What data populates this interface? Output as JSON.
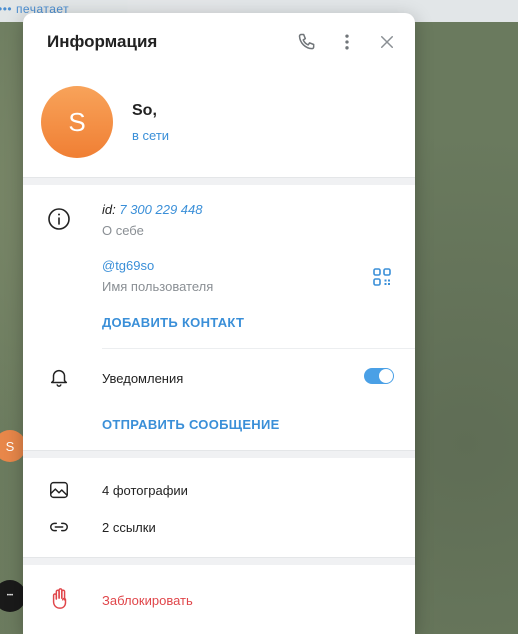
{
  "background": {
    "topbar_text": "••• печатает",
    "avatar_letter": "S",
    "dark_avatar_text": "•••"
  },
  "dialog": {
    "title": "Информация"
  },
  "profile": {
    "avatar_letter": "S",
    "name": "So,",
    "status": "в сети",
    "avatar_colors": [
      "#f8a35a",
      "#f07f34"
    ]
  },
  "info": {
    "id_label": "id:",
    "id_value": "7 300 229 448",
    "bio_caption": "О себе",
    "username": "@tg69so",
    "username_caption": "Имя пользователя",
    "add_contact": "ДОБАВИТЬ КОНТАКТ"
  },
  "notifications": {
    "label": "Уведомления",
    "enabled": true,
    "send_message": "ОТПРАВИТЬ СООБЩЕНИЕ"
  },
  "media": {
    "photos": "4 фотографии",
    "links": "2 ссылки"
  },
  "block": {
    "label": "Заблокировать"
  },
  "colors": {
    "accent": "#3a8fd8",
    "danger": "#e0464a",
    "toggle": "#4aa0e6"
  }
}
